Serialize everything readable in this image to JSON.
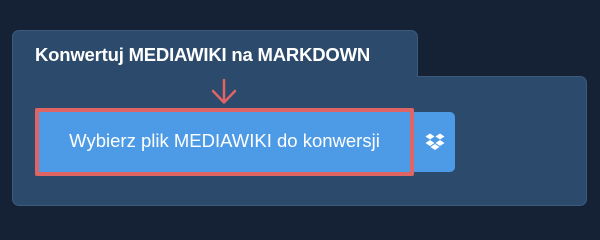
{
  "converter": {
    "title": "Konwertuj MEDIAWIKI na MARKDOWN",
    "upload_button_label": "Wybierz plik MEDIAWIKI do konwersji",
    "cloud_button_icon": "dropbox-icon",
    "arrow_icon": "down-arrow-icon"
  },
  "colors": {
    "page_background": "#152236",
    "card_background": "#2c4a6c",
    "button_background": "#4d9be6",
    "highlight_border": "#df6565",
    "text": "#ffffff"
  }
}
